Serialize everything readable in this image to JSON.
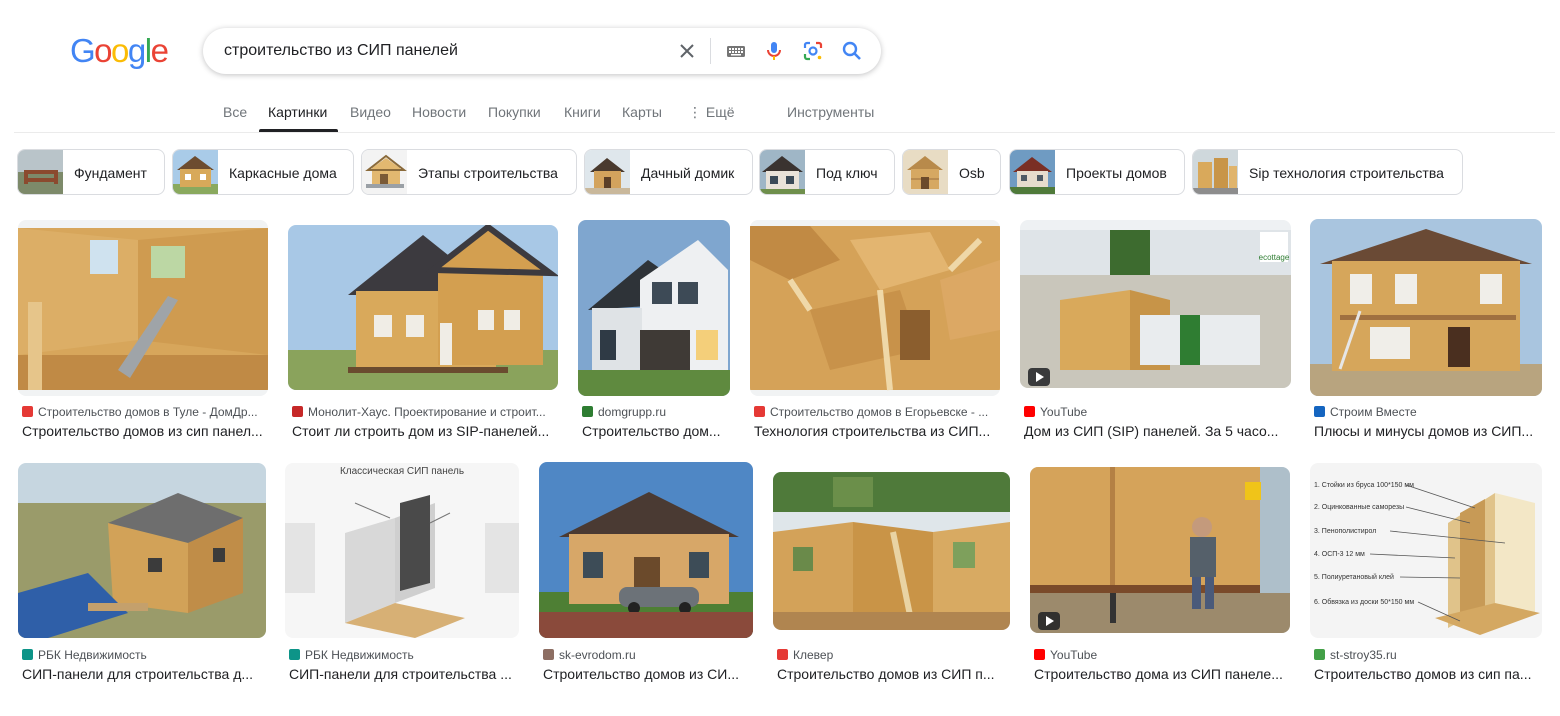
{
  "search": {
    "query": "строительство из СИП панелей",
    "icons": [
      "close-icon",
      "keyboard-icon",
      "microphone-icon",
      "google-lens-icon",
      "search-icon"
    ]
  },
  "logo": {
    "letters": [
      "G",
      "o",
      "o",
      "g",
      "l",
      "e"
    ],
    "colors": [
      "#4285F4",
      "#EA4335",
      "#FBBC05",
      "#4285F4",
      "#34A853",
      "#EA4335"
    ]
  },
  "tabs": {
    "all": "Все",
    "images": "Картинки",
    "videos": "Видео",
    "news": "Новости",
    "shopping": "Покупки",
    "books": "Книги",
    "maps": "Карты",
    "more": "⋮ Ещё",
    "tools": "Инструменты"
  },
  "chips": [
    {
      "label": "Фундамент"
    },
    {
      "label": "Каркасные дома"
    },
    {
      "label": "Этапы строительства"
    },
    {
      "label": "Дачный домик"
    },
    {
      "label": "Под ключ"
    },
    {
      "label": "Osb"
    },
    {
      "label": "Проекты домов"
    },
    {
      "label": "Sip технология строительства"
    }
  ],
  "results": [
    {
      "source": "Строительство домов в Туле - ДомДр...",
      "title": "Строительство домов из сип панел...",
      "favicon_color": "#e53935",
      "image": "interior-osb-walls"
    },
    {
      "source": "Монолит-Хаус. Проектирование и строит...",
      "title": "Стоит ли строить дом из SIP-панелей...",
      "favicon_color": "#c62828",
      "image": "two-storey-sip-house"
    },
    {
      "source": "domgrupp.ru",
      "title": "Строительство дом...",
      "favicon_color": "#2e7d32",
      "image": "modern-white-house"
    },
    {
      "source": "Строительство домов в Егорьевске - ...",
      "title": "Технология строительства из СИП...",
      "favicon_color": "#e53935",
      "image": "osb-wall-frames"
    },
    {
      "source": "YouTube",
      "title": "Дом из СИП (SIP) панелей. За 5 часо...",
      "favicon_color": "#ff0000",
      "image": "sip-assembly-video",
      "video": true
    },
    {
      "source": "Строим Вместе",
      "title": "Плюсы и минусы домов из СИП...",
      "favicon_color": "#1565c0",
      "image": "sip-house-ladder"
    },
    {
      "source": "РБК Недвижимость",
      "title": "СИП-панели для строительства д...",
      "favicon_color": "#0d9488",
      "image": "aerial-sip-house"
    },
    {
      "source": "РБК Недвижимость",
      "title": "СИП-панели для строительства ...",
      "favicon_color": "#0d9488",
      "image": "sip-panel-diagram",
      "caption": "Классическая СИП панель"
    },
    {
      "source": "sk-evrodom.ru",
      "title": "Строительство домов из СИ...",
      "favicon_color": "#8d6e63",
      "image": "finished-house-car"
    },
    {
      "source": "Клевер",
      "title": "Строительство домов из СИП п...",
      "favicon_color": "#e53935",
      "image": "walls-in-progress"
    },
    {
      "source": "YouTube",
      "title": "Строительство дома из СИП панеле...",
      "favicon_color": "#ff0000",
      "image": "man-at-sip-house",
      "video": true
    },
    {
      "source": "st-stroy35.ru",
      "title": "Строительство домов из сип па...",
      "favicon_color": "#43a047",
      "image": "sip-layers-diagram"
    }
  ],
  "panel_diagram_labels": [
    "1. Стойки из бруса 100*150 мм",
    "2. Оцинкованные саморезы",
    "3. Пенополистирол",
    "4. ОСП-3 12 мм",
    "5. Полиуретановый клей",
    "6. Обвязка из доски 50*150 мм"
  ],
  "watermark": "ecottage",
  "colors": {
    "link_gray": "#70757a",
    "border": "#dadce0",
    "osb": "#d9a95b",
    "sky": "#9ec3e6"
  }
}
